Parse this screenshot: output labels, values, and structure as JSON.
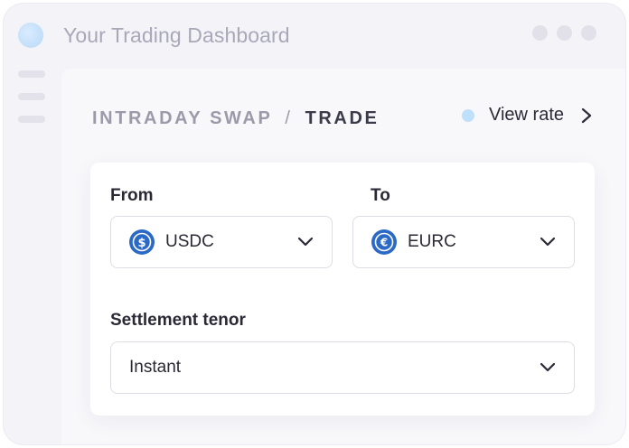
{
  "window": {
    "title": "Your Trading Dashboard"
  },
  "header": {
    "breadcrumb_section": "INTRADAY SWAP",
    "breadcrumb_separator": "/",
    "breadcrumb_page": "TRADE",
    "view_rate_label": "View rate"
  },
  "form": {
    "from_label": "From",
    "from_value": "USDC",
    "from_icon": "usdc-dollar-coin-icon",
    "to_label": "To",
    "to_value": "EURC",
    "to_icon": "eurc-euro-coin-icon",
    "tenor_label": "Settlement tenor",
    "tenor_value": "Instant"
  },
  "colors": {
    "coin_blue": "#2b69c6",
    "rate_indicator": "#bfe0fb",
    "text_dark": "#2a2935"
  }
}
